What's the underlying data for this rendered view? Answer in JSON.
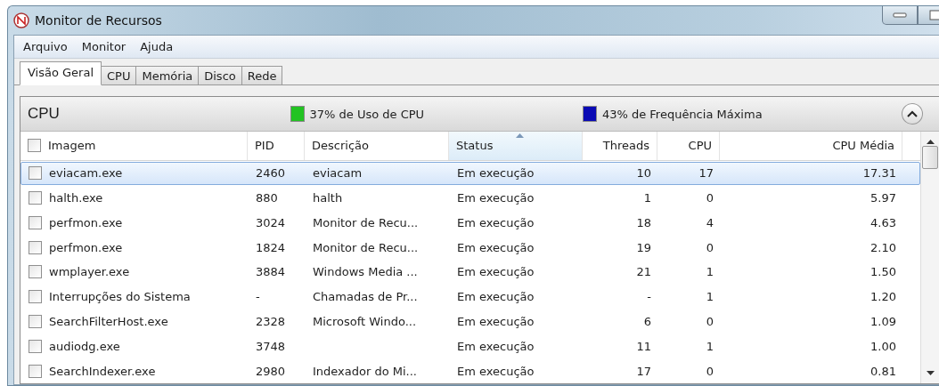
{
  "window": {
    "title": "Monitor de Recursos"
  },
  "menu": [
    "Arquivo",
    "Monitor",
    "Ajuda"
  ],
  "tabs": [
    {
      "label": "Visão Geral",
      "selected": true
    },
    {
      "label": "CPU",
      "selected": false
    },
    {
      "label": "Memória",
      "selected": false
    },
    {
      "label": "Disco",
      "selected": false
    },
    {
      "label": "Rede",
      "selected": false
    }
  ],
  "section": {
    "title": "CPU",
    "expanded": true,
    "indicators": [
      {
        "label": "37% de Uso de CPU",
        "color": "#22c322"
      },
      {
        "label": "43% de Frequência Máxima",
        "color": "#0a0ab4"
      }
    ]
  },
  "table": {
    "select_all_checked": false,
    "columns": [
      {
        "label": "Imagem",
        "kind": "text",
        "sorted": false
      },
      {
        "label": "PID",
        "kind": "text",
        "sorted": false
      },
      {
        "label": "Descrição",
        "kind": "text",
        "sorted": false
      },
      {
        "label": "Status",
        "kind": "text",
        "sorted": true
      },
      {
        "label": "Threads",
        "kind": "number",
        "sorted": false
      },
      {
        "label": "CPU",
        "kind": "number",
        "sorted": false
      },
      {
        "label": "CPU Média",
        "kind": "number",
        "sorted": false
      }
    ],
    "rows": [
      {
        "selected": true,
        "checked": false,
        "cells": [
          "eviacam.exe",
          "2460",
          "eviacam",
          "Em execução",
          "10",
          "17",
          "17.31"
        ]
      },
      {
        "selected": false,
        "checked": false,
        "cells": [
          "halth.exe",
          "880",
          "halth",
          "Em execução",
          "1",
          "0",
          "5.97"
        ]
      },
      {
        "selected": false,
        "checked": false,
        "cells": [
          "perfmon.exe",
          "3024",
          "Monitor de Recu...",
          "Em execução",
          "18",
          "4",
          "4.63"
        ]
      },
      {
        "selected": false,
        "checked": false,
        "cells": [
          "perfmon.exe",
          "1824",
          "Monitor de Recu...",
          "Em execução",
          "19",
          "0",
          "2.10"
        ]
      },
      {
        "selected": false,
        "checked": false,
        "cells": [
          "wmplayer.exe",
          "3884",
          "Windows Media ...",
          "Em execução",
          "21",
          "1",
          "1.50"
        ]
      },
      {
        "selected": false,
        "checked": false,
        "cells": [
          "Interrupções do Sistema",
          "-",
          "Chamadas de Pr...",
          "Em execução",
          "-",
          "1",
          "1.20"
        ]
      },
      {
        "selected": false,
        "checked": false,
        "cells": [
          "SearchFilterHost.exe",
          "2328",
          "Microsoft Windo...",
          "Em execução",
          "6",
          "0",
          "1.09"
        ]
      },
      {
        "selected": false,
        "checked": false,
        "cells": [
          "audiodg.exe",
          "3748",
          "",
          "Em execução",
          "11",
          "1",
          "1.00"
        ]
      },
      {
        "selected": false,
        "checked": false,
        "cells": [
          "SearchIndexer.exe",
          "2980",
          "Indexador do Mi...",
          "Em execução",
          "17",
          "0",
          "0.81"
        ]
      }
    ]
  }
}
